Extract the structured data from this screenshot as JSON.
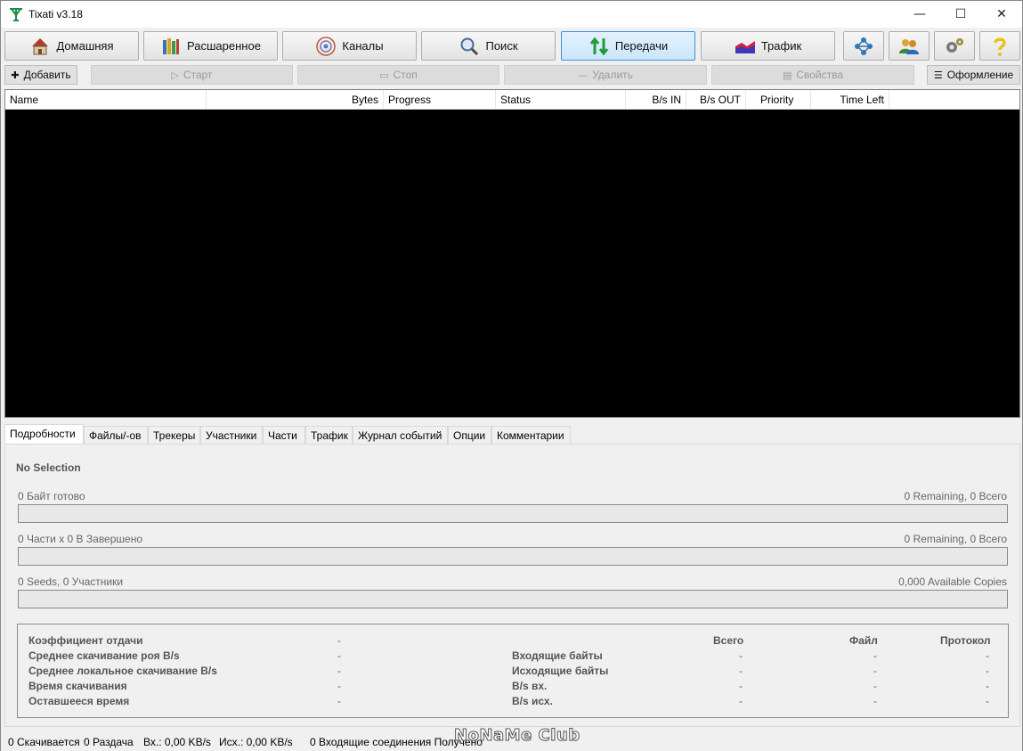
{
  "window": {
    "title": "Tixati v3.18",
    "controls": [
      "—",
      "☐",
      "✕"
    ]
  },
  "nav": {
    "items": [
      {
        "label": "Домашняя",
        "icon": "home-icon"
      },
      {
        "label": "Расшаренное",
        "icon": "books-icon"
      },
      {
        "label": "Каналы",
        "icon": "broadcast-icon"
      },
      {
        "label": "Поиск",
        "icon": "magnifier-icon"
      },
      {
        "label": "Передачи",
        "icon": "transfer-arrows-icon",
        "active": true
      },
      {
        "label": "Трафик",
        "icon": "traffic-chart-icon"
      }
    ],
    "icon_buttons": [
      "network-icon",
      "users-icon",
      "gears-icon",
      "help-icon"
    ]
  },
  "actions": {
    "add": "Добавить",
    "start": "Старт",
    "stop": "Стоп",
    "remove": "Удалить",
    "properties": "Свойства",
    "layout": "Оформление"
  },
  "list": {
    "columns": [
      "Name",
      "Bytes",
      "Progress",
      "Status",
      "B/s IN",
      "B/s OUT",
      "Priority",
      "Time Left"
    ]
  },
  "tabs": [
    "Подробности",
    "Файлы/-ов",
    "Трекеры",
    "Участники",
    "Части",
    "Трафик",
    "Журнал событий",
    "Опции",
    "Комментарии"
  ],
  "details": {
    "selection": "No Selection",
    "bytes_done": "0 Байт готово",
    "bytes_remaining": "0 Remaining,  0 Всего",
    "pieces_done": "0 Части  x  0 В Завершено",
    "pieces_remaining": "0 Remaining,  0 Всего",
    "peers": "0 Seeds, 0 Участники",
    "available_copies": "0,000 Available Copies",
    "stats_left": [
      {
        "label": "Коэффициент отдачи",
        "value": "-"
      },
      {
        "label": "Среднее скачивание роя B/s",
        "value": "-"
      },
      {
        "label": "Среднее локальное скачивание B/s",
        "value": "-"
      },
      {
        "label": "Время скачивания",
        "value": "-"
      },
      {
        "label": "Оставшееся время",
        "value": "-"
      }
    ],
    "stats_headers": [
      "Всего",
      "Файл",
      "Протокол"
    ],
    "stats_right": [
      {
        "label": "Входящие байты",
        "values": [
          "-",
          "-",
          "-"
        ]
      },
      {
        "label": "Исходящие байты",
        "values": [
          "-",
          "-",
          "-"
        ]
      },
      {
        "label": "B/s вх.",
        "values": [
          "-",
          "-",
          "-"
        ]
      },
      {
        "label": "B/s исх.",
        "values": [
          "-",
          "-",
          "-"
        ]
      }
    ]
  },
  "status": {
    "downloading": "0 Скачивается",
    "seeding": "0 Раздача",
    "in_rate": "Вх.: 0,00 KB/s",
    "out_rate": "Исх.: 0,00 KB/s",
    "incoming": "0 Входящие соединения Получено"
  },
  "watermark": "NoNaMe Club"
}
